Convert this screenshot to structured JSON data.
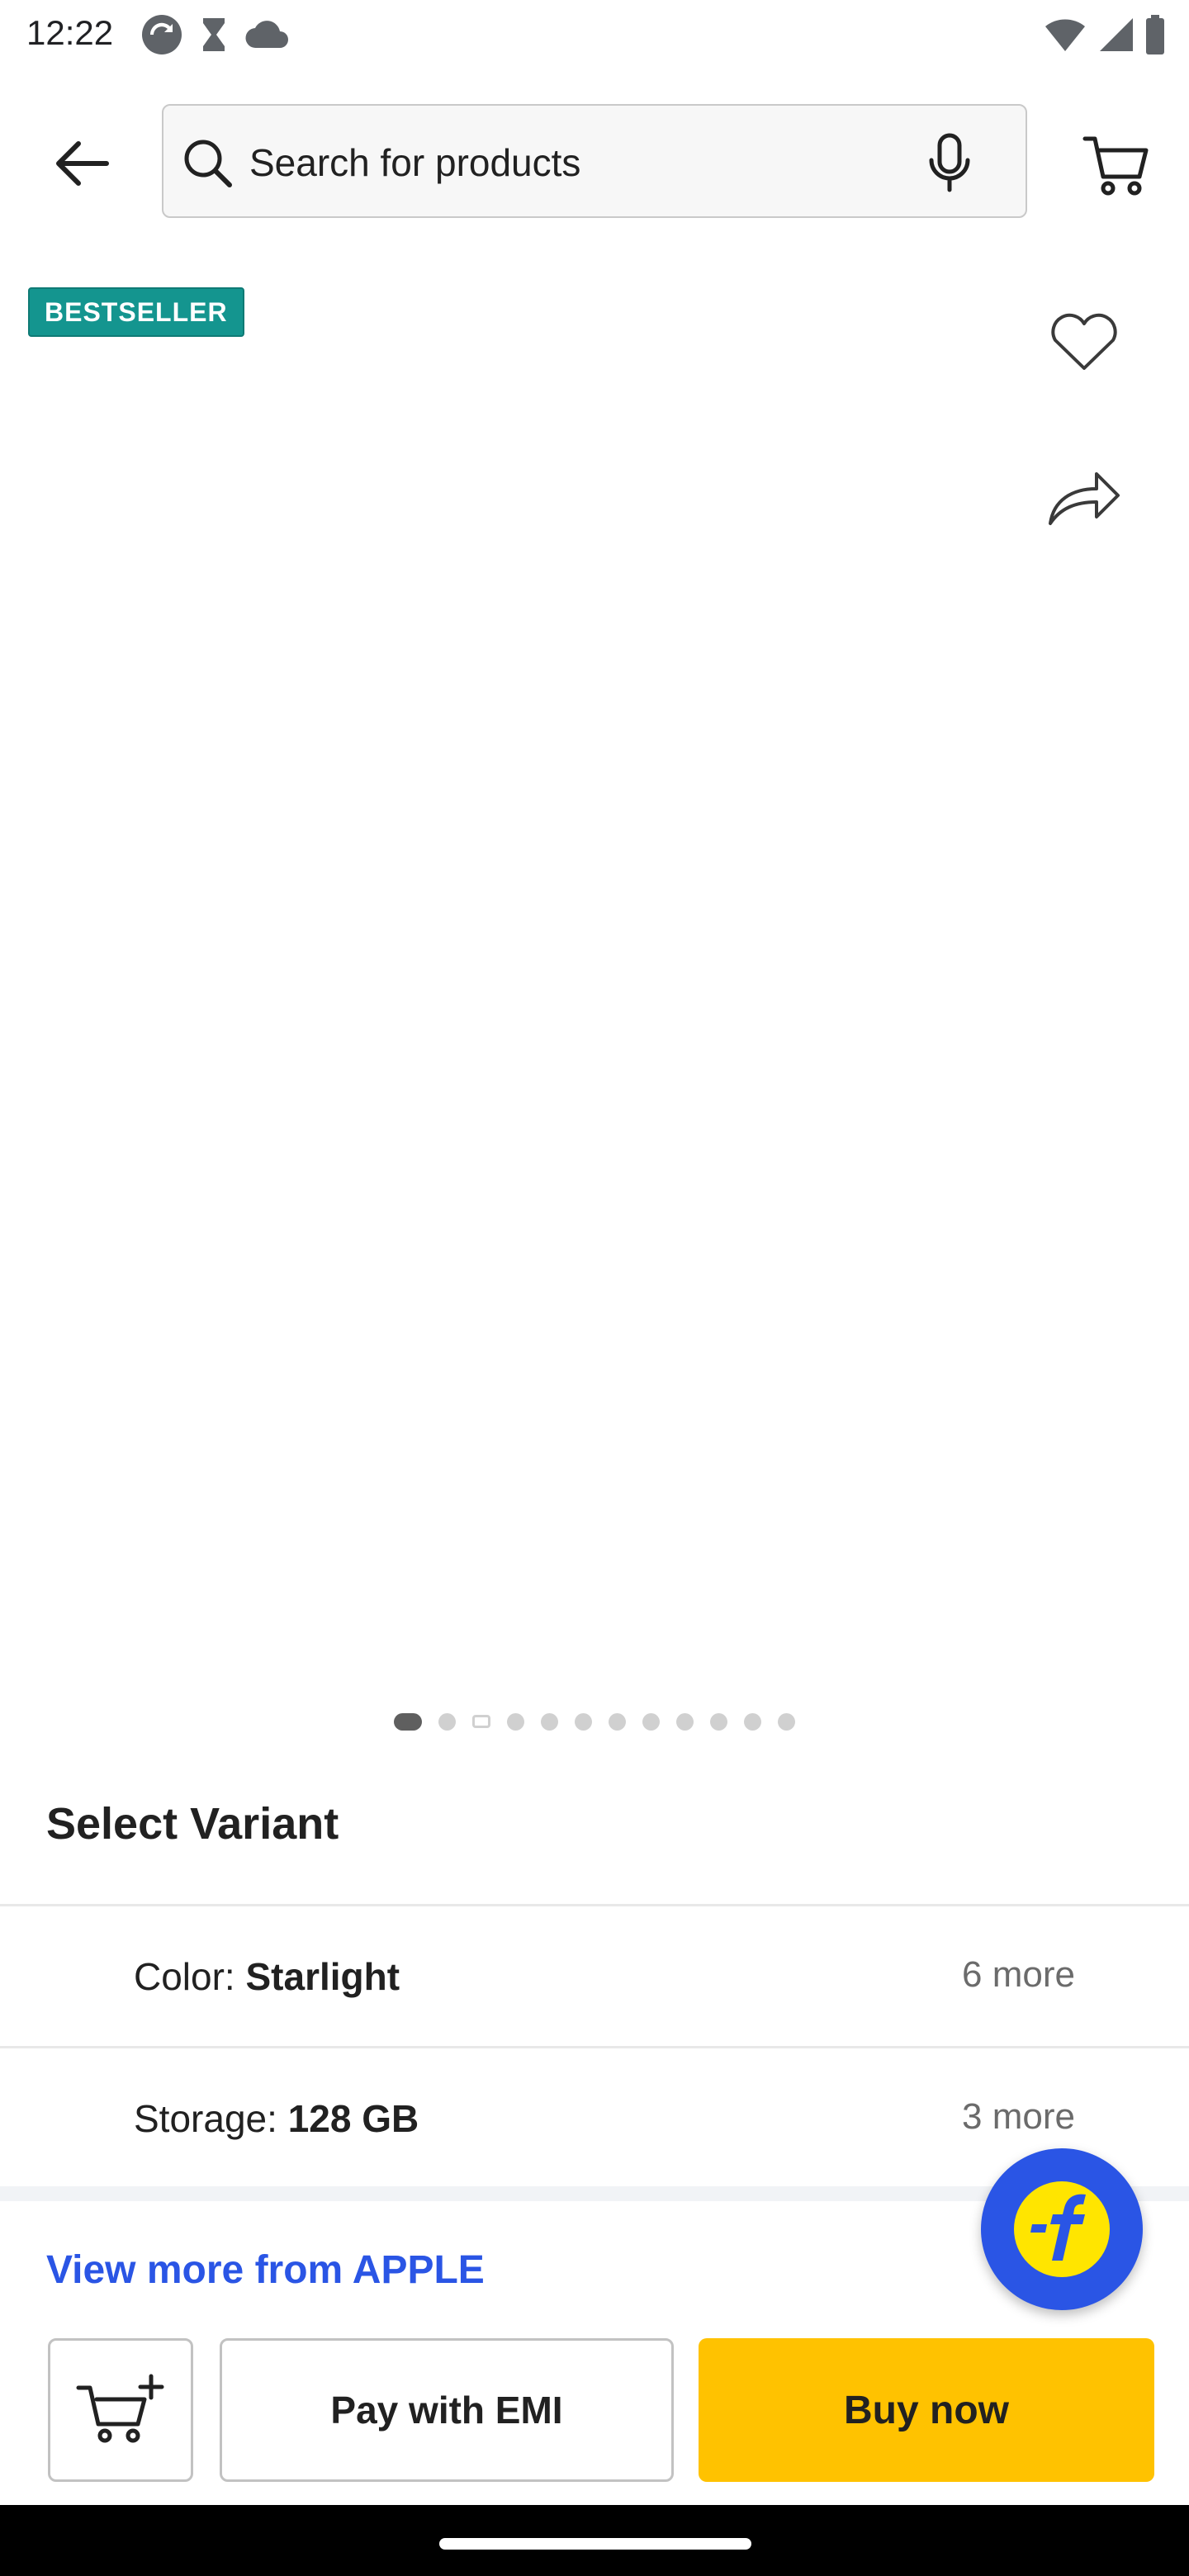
{
  "status_bar": {
    "time": "12:22",
    "left_icons": [
      "sync-icon",
      "hourglass-icon",
      "cloud-icon"
    ],
    "right_icons": [
      "wifi-icon",
      "signal-icon",
      "battery-icon"
    ]
  },
  "header": {
    "search_placeholder": "Search for products",
    "icons": [
      "back-arrow-icon",
      "search-icon",
      "mic-icon",
      "cart-icon"
    ]
  },
  "gallery": {
    "badge": "BESTSELLER",
    "image_count": 12,
    "active_index": 0,
    "video_index": 2
  },
  "variants": {
    "title": "Select Variant",
    "rows": [
      {
        "key": "Color: ",
        "value": "Starlight",
        "more": "6 more"
      },
      {
        "key": "Storage: ",
        "value": "128 GB",
        "more": "3 more"
      }
    ]
  },
  "view_more": "View more from APPLE",
  "actions": {
    "emi_label": "Pay with EMI",
    "buy_label": "Buy now"
  },
  "colors": {
    "accent_blue": "#2a55e5",
    "buy_yellow": "#ffc200",
    "badge_teal": "#14958f"
  }
}
